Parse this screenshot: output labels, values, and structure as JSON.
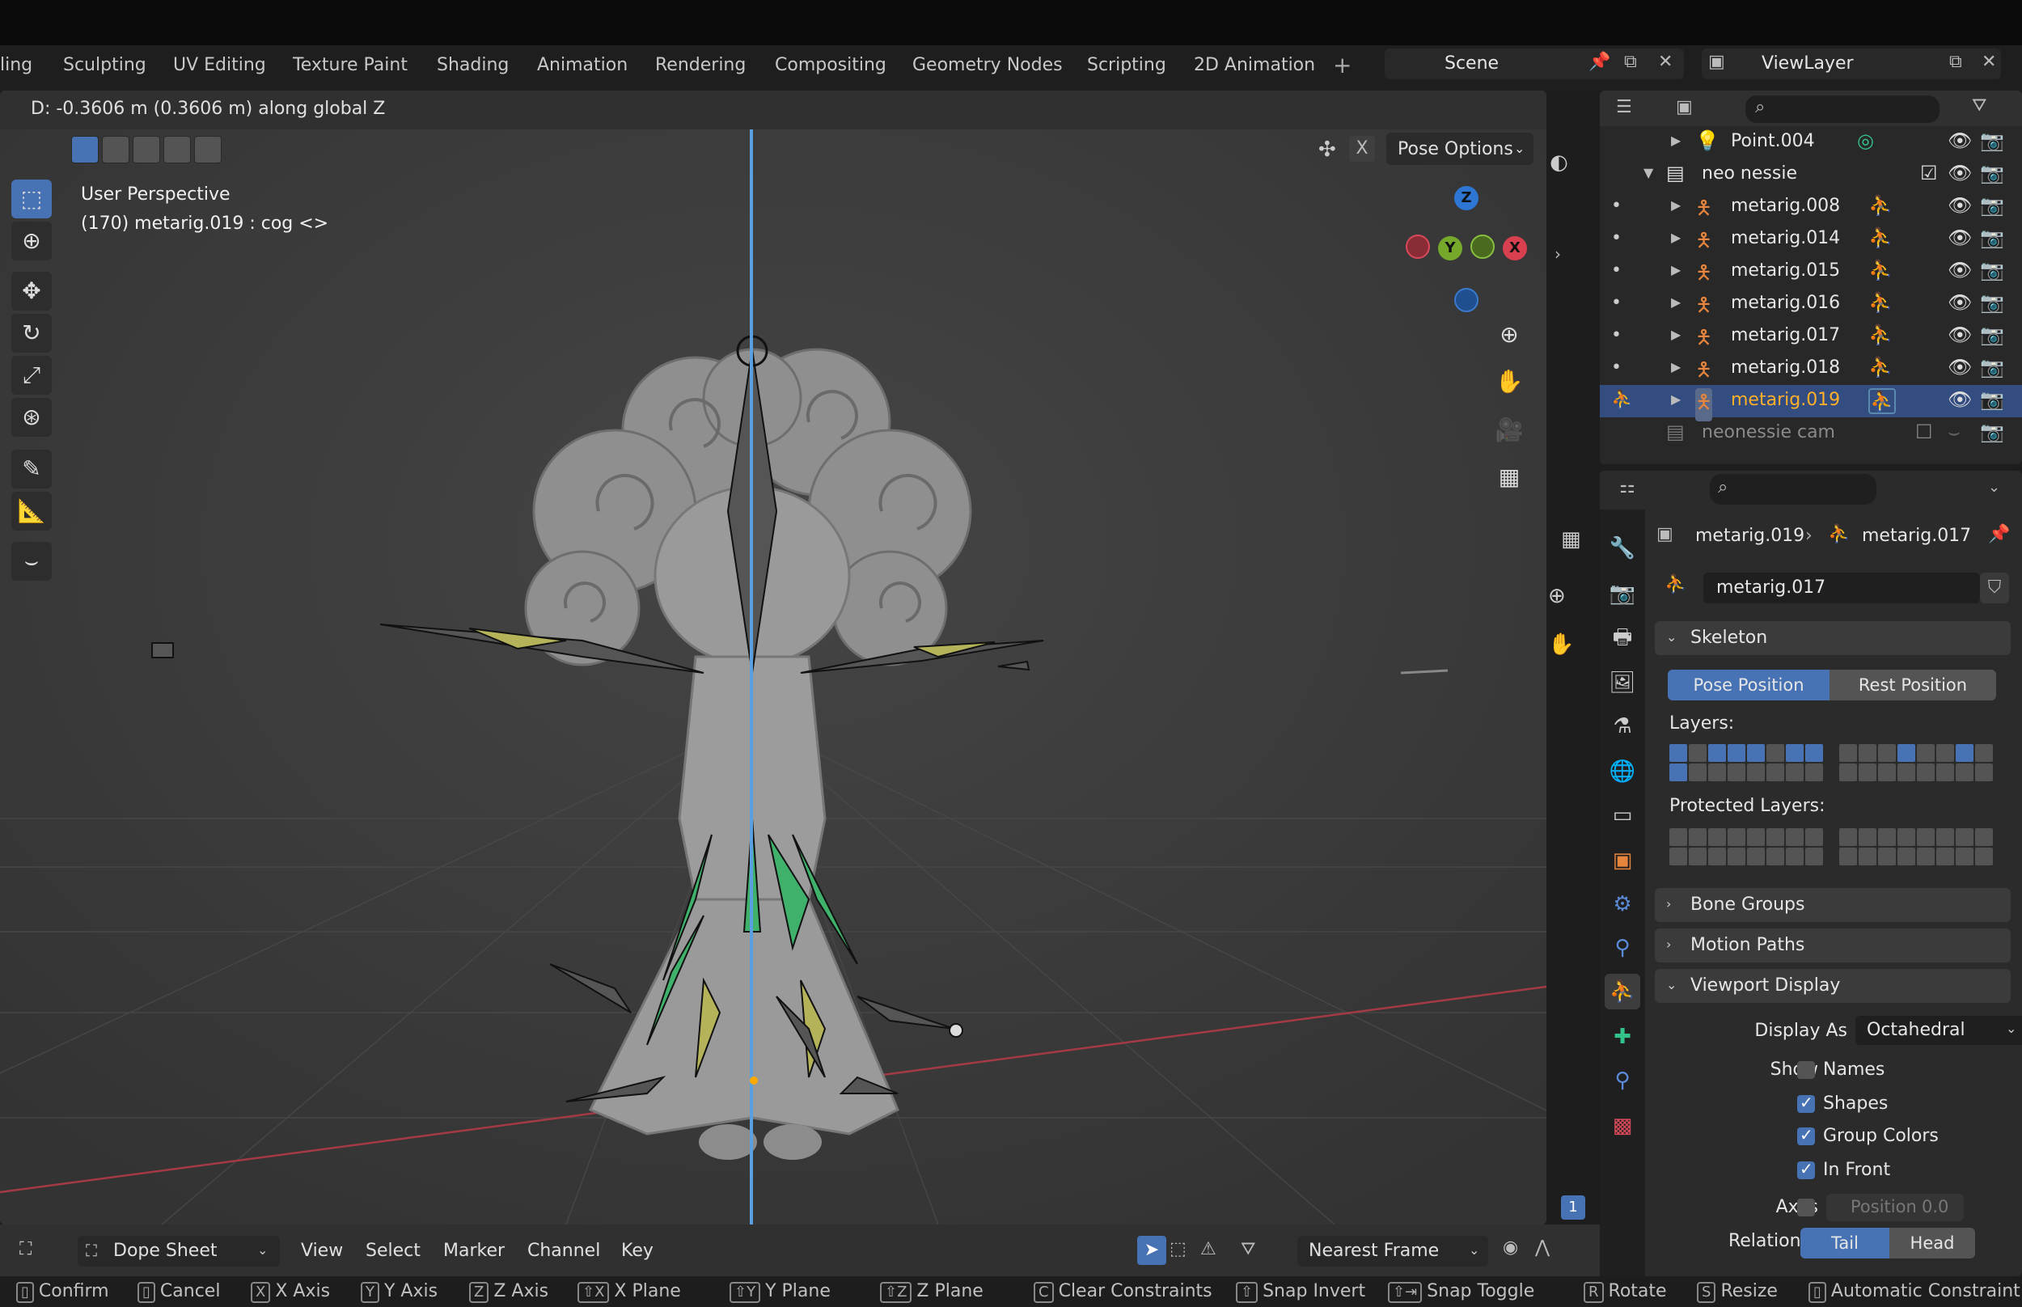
{
  "workspaces": [
    "ling",
    "Sculpting",
    "UV Editing",
    "Texture Paint",
    "Shading",
    "Animation",
    "Rendering",
    "Compositing",
    "Geometry Nodes",
    "Scripting",
    "2D Animation"
  ],
  "workspace_add": "+",
  "scene": {
    "name": "Scene"
  },
  "view_layer": {
    "name": "ViewLayer"
  },
  "viewport": {
    "header_message": "D: -0.3606 m (0.3606 m) along global Z",
    "perspective": "User Perspective",
    "active_info": "(170) metarig.019 : cog <>",
    "pose_options": "Pose Options",
    "x_button": "X",
    "gizmo": {
      "z": "Z",
      "y": "Y",
      "x": "X"
    }
  },
  "outliner": {
    "rows": [
      {
        "label": "Point.004",
        "type": "light"
      },
      {
        "label": "neo nessie",
        "type": "collection"
      },
      {
        "label": "metarig.008",
        "type": "armature"
      },
      {
        "label": "metarig.014",
        "type": "armature"
      },
      {
        "label": "metarig.015",
        "type": "armature"
      },
      {
        "label": "metarig.016",
        "type": "armature"
      },
      {
        "label": "metarig.017",
        "type": "armature"
      },
      {
        "label": "metarig.018",
        "type": "armature"
      },
      {
        "label": "metarig.019",
        "type": "armature",
        "active": true
      },
      {
        "label": "neonessie cam",
        "type": "collection-disabled"
      }
    ]
  },
  "properties": {
    "breadcrumb_object": "metarig.019",
    "breadcrumb_data": "metarig.017",
    "data_name": "metarig.017",
    "skeleton": {
      "title": "Skeleton",
      "pose_position": "Pose Position",
      "rest_position": "Rest Position",
      "layers_label": "Layers:",
      "protected_label": "Protected Layers:"
    },
    "bone_groups": "Bone Groups",
    "motion_paths": "Motion Paths",
    "viewport_display": {
      "title": "Viewport Display",
      "display_as_label": "Display As",
      "display_as_value": "Octahedral",
      "show_label": "Show",
      "names": "Names",
      "shapes": "Shapes",
      "group_colors": "Group Colors",
      "in_front": "In Front",
      "axes_label": "Axes",
      "position_label": "Position",
      "position_value": "0.0",
      "relations_label": "Relations",
      "tail": "Tail",
      "head": "Head"
    },
    "frame_number": "1"
  },
  "dope_sheet": {
    "mode": "Dope Sheet",
    "menus": [
      "View",
      "Select",
      "Marker",
      "Channel",
      "Key"
    ],
    "snapping": "Nearest Frame"
  },
  "status_bar": [
    {
      "label": "Confirm"
    },
    {
      "label": "Cancel"
    },
    {
      "key": "X",
      "label": "X Axis"
    },
    {
      "key": "Y",
      "label": "Y Axis"
    },
    {
      "key": "Z",
      "label": "Z Axis"
    },
    {
      "key": "⇧X",
      "label": "X Plane"
    },
    {
      "key": "⇧Y",
      "label": "Y Plane"
    },
    {
      "key": "⇧Z",
      "label": "Z Plane"
    },
    {
      "key": "C",
      "label": "Clear Constraints"
    },
    {
      "key": "⇧",
      "label": "Snap Invert"
    },
    {
      "key": "⇧⇥",
      "label": "Snap Toggle"
    },
    {
      "key": "R",
      "label": "Rotate"
    },
    {
      "key": "S",
      "label": "Resize"
    },
    {
      "label": "Automatic Constraint"
    }
  ],
  "colors": {
    "accent": "#4772b3",
    "active_object": "#ffaf29",
    "armature_green": "#33c28a"
  }
}
